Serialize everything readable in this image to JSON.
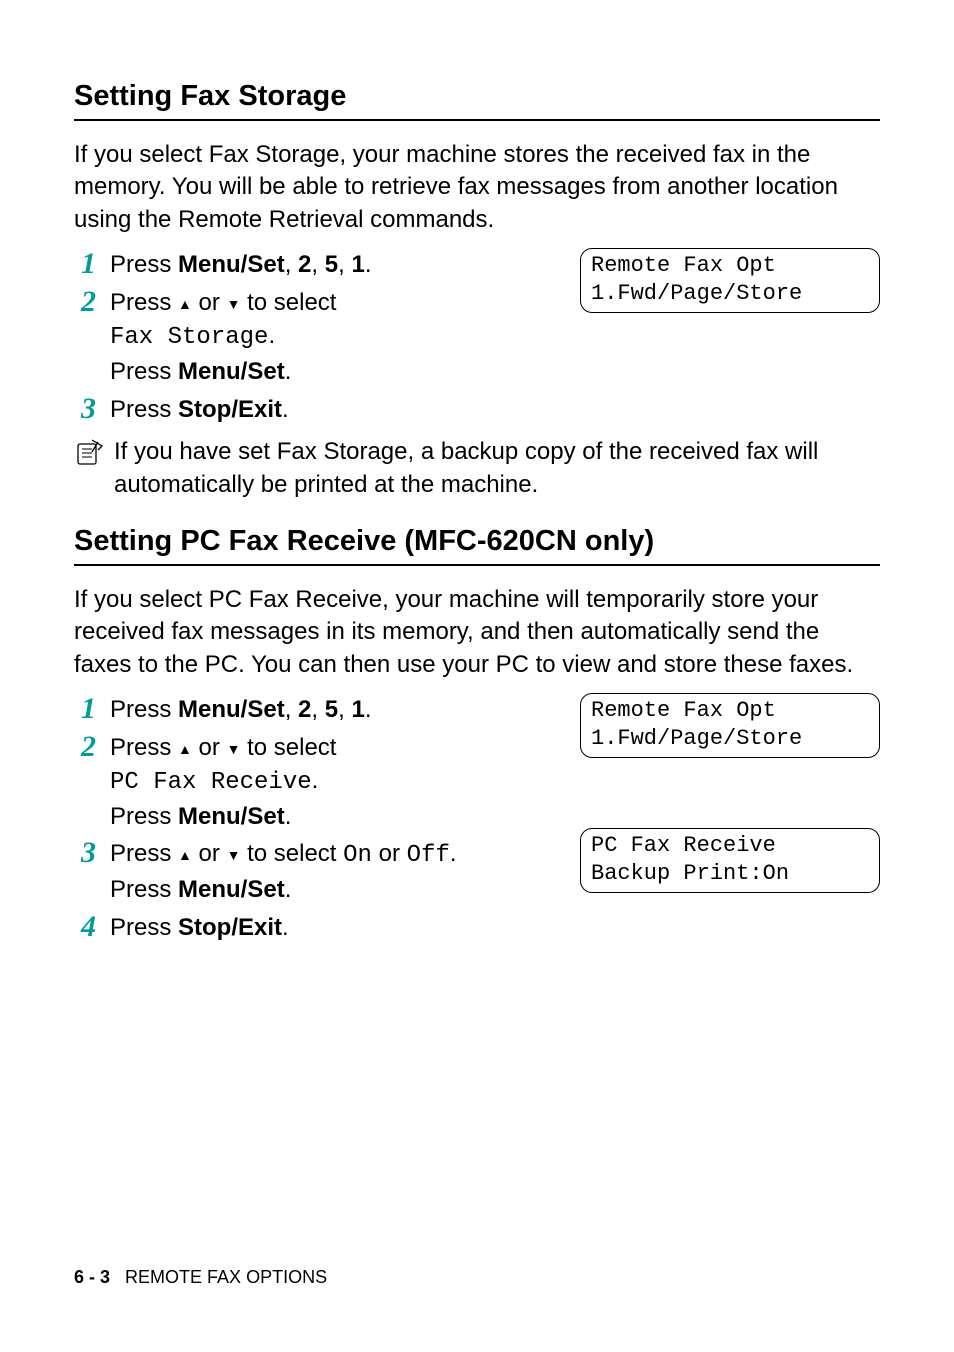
{
  "section1": {
    "heading": "Setting Fax Storage",
    "intro": "If you select Fax Storage, your machine stores the received fax in the memory. You will be able to retrieve fax messages from another location using the Remote Retrieval commands.",
    "steps": {
      "s1": {
        "num": "1",
        "press": "Press ",
        "menu": "Menu/Set",
        "seq": ", ",
        "k2": "2",
        "k5": "5",
        "k1": "1",
        "dot": "."
      },
      "s2": {
        "num": "2",
        "press": "Press ",
        "or": " or ",
        "to": " to select",
        "opt": "Fax Storage",
        "dot": ".",
        "pressb": "Press ",
        "menu": "Menu/Set",
        "dot2": "."
      },
      "s3": {
        "num": "3",
        "press": "Press ",
        "stop": "Stop/Exit",
        "dot": "."
      }
    },
    "lcd": {
      "l1": "Remote Fax Opt",
      "l2": "1.Fwd/Page/Store"
    },
    "note": "If you have set Fax Storage, a backup copy of the received fax will automatically be printed at the machine."
  },
  "section2": {
    "heading": "Setting PC Fax Receive (MFC-620CN only)",
    "intro": "If you select PC Fax Receive, your machine will temporarily store your received fax messages in its memory, and then automatically send the faxes to the PC. You can then use your PC to view and store these faxes.",
    "steps": {
      "s1": {
        "num": "1",
        "press": "Press ",
        "menu": "Menu/Set",
        "seq": ", ",
        "k2": "2",
        "k5": "5",
        "k1": "1",
        "dot": "."
      },
      "s2": {
        "num": "2",
        "press": "Press ",
        "or": " or ",
        "to": " to select",
        "opt": "PC Fax Receive",
        "dot": ".",
        "pressb": "Press ",
        "menu": "Menu/Set",
        "dot2": "."
      },
      "s3": {
        "num": "3",
        "press": "Press ",
        "or": " or ",
        "to": " to select ",
        "on": "On",
        "ortxt": " or ",
        "off": "Off",
        "dot": ".",
        "pressb": "Press ",
        "menu": "Menu/Set",
        "dot2": "."
      },
      "s4": {
        "num": "4",
        "press": "Press ",
        "stop": "Stop/Exit",
        "dot": "."
      }
    },
    "lcd1": {
      "l1": "Remote Fax Opt",
      "l2": "1.Fwd/Page/Store"
    },
    "lcd2": {
      "l1": "PC Fax Receive",
      "l2": "Backup Print:On"
    }
  },
  "footer": {
    "page": "6 - 3",
    "title": "REMOTE FAX OPTIONS"
  }
}
